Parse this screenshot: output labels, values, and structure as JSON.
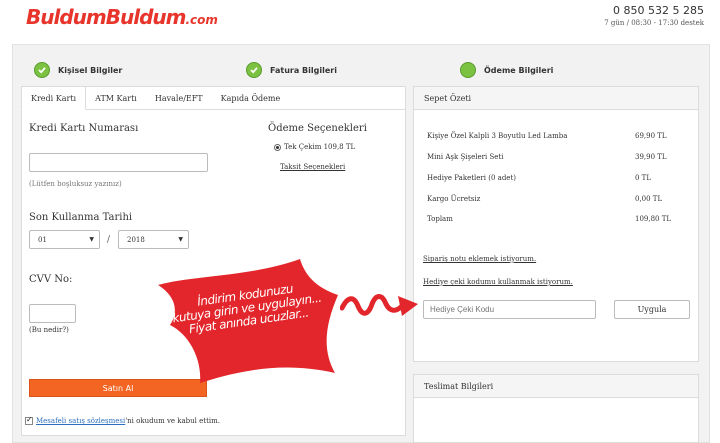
{
  "header": {
    "logo": "BuldumBuldum",
    "logo_suffix": ".com",
    "phone": "0 850 532 5 285",
    "hours": "7 gün / 08:30 - 17:30 destek"
  },
  "steps": [
    {
      "label": "Kişisel Bilgiler"
    },
    {
      "label": "Fatura Bilgileri"
    },
    {
      "label": "Ödeme Bilgileri"
    }
  ],
  "tabs": [
    {
      "label": "Kredi Kartı"
    },
    {
      "label": "ATM Kartı"
    },
    {
      "label": "Havale/EFT"
    },
    {
      "label": "Kapıda Ödeme"
    }
  ],
  "form": {
    "card_number_label": "Kredi Kartı Numarası",
    "card_number_value": "",
    "card_number_hint": "(Lütfen boşluksuz yazınız)",
    "expiry_label": "Son Kullanma Tarihi",
    "expiry_month": "01",
    "expiry_separator": "/",
    "expiry_year": "2018",
    "cvv_label": "CVV No:",
    "cvv_value": "",
    "cvv_hint": "(Bu nedir?)",
    "buy_label": "Satın Al",
    "agree_link": "Mesafeli satış sözleşmesi",
    "agree_rest": "'ni okudum ve kabul ettim."
  },
  "payment_options": {
    "title": "Ödeme Seçenekleri",
    "single": "Tek Çekim 109,8 TL",
    "installment_link": "Taksit Seçenekleri"
  },
  "summary": {
    "title": "Sepet Özeti",
    "rows": [
      {
        "label": "Kişiye Özel Kalpli 3 Boyutlu Led Lamba",
        "value": "69,90 TL"
      },
      {
        "label": "Mini Aşk Şişeleri Seti",
        "value": "39,90 TL"
      },
      {
        "label": "Hediye Paketleri (0 adet)",
        "value": "0 TL"
      },
      {
        "label": "Kargo Ücretsiz",
        "value": "0,00 TL"
      },
      {
        "label": "Toplam",
        "value": "109,80 TL"
      }
    ],
    "order_note_link": "Sipariş notu eklemek istiyorum.",
    "gift_code_link": "Hediye çeki kodumu kullanmak istiyorum.",
    "gift_code_placeholder": "Hediye Çeki Kodu",
    "apply_label": "Uygula"
  },
  "delivery": {
    "title": "Teslimat Bilgileri"
  },
  "promo": {
    "line1": "İndirim kodunuzu",
    "line2": "kutuya girin ve uygulayın...",
    "line3": "Fiyat anında ucuzlar..."
  },
  "colors": {
    "brand": "#e8352b",
    "buy": "#f26522",
    "check": "#7cc242",
    "promo_red": "#e3262b"
  }
}
